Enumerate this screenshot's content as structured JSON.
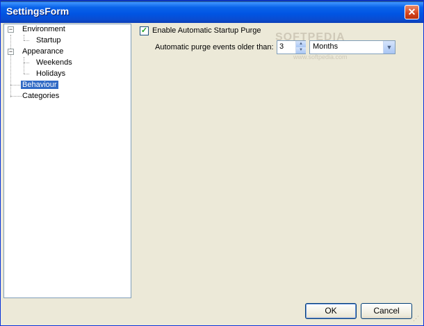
{
  "window": {
    "title": "SettingsForm",
    "close_label": "✕"
  },
  "tree": {
    "items": [
      {
        "label": "Environment",
        "expander": "−"
      },
      {
        "label": "Startup"
      },
      {
        "label": "Appearance",
        "expander": "−"
      },
      {
        "label": "Weekends"
      },
      {
        "label": "Holidays"
      },
      {
        "label": "Behaviour",
        "selected": true
      },
      {
        "label": "Categories"
      }
    ]
  },
  "behaviour": {
    "enable_purge_label": "Enable Automatic Startup Purge",
    "enable_purge_checked": true,
    "check_mark": "✓",
    "purge_older_label": "Automatic purge events older than:",
    "purge_value": "3",
    "purge_unit": "Months"
  },
  "buttons": {
    "ok": "OK",
    "cancel": "Cancel"
  },
  "watermark": {
    "text": "SOFTPEDIA",
    "url": "www.softpedia.com"
  }
}
